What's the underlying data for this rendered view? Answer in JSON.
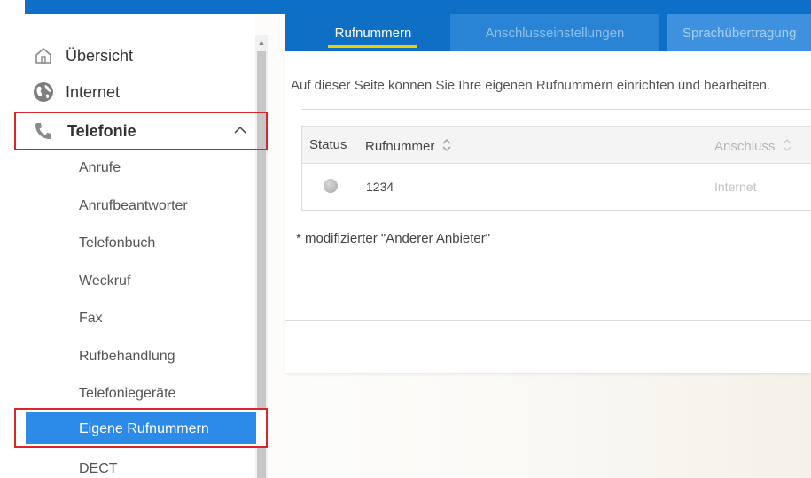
{
  "nav": {
    "overview": "Übersicht",
    "internet": "Internet",
    "telefonie": "Telefonie",
    "sub": {
      "anrufe": "Anrufe",
      "anrufbeantworter": "Anrufbeantworter",
      "telefonbuch": "Telefonbuch",
      "weckruf": "Weckruf",
      "fax": "Fax",
      "rufbehandlung": "Rufbehandlung",
      "telefoniegeraete": "Telefoniegeräte",
      "eigene": "Eigene Rufnummern",
      "dect": "DECT"
    }
  },
  "tabs": [
    "Rufnummern",
    "Anschlusseinstellungen",
    "Sprachübertragung"
  ],
  "intro": "Auf dieser Seite können Sie Ihre eigenen Rufnummern einrichten und bearbeiten.",
  "table": {
    "headers": {
      "status": "Status",
      "rufnummer": "Rufnummer",
      "anschluss": "Anschluss"
    },
    "rows": [
      {
        "rufnummer": "1234",
        "anschluss": "Internet"
      }
    ]
  },
  "note": "* modifizierter \"Anderer Anbieter\"",
  "colors": {
    "brand_blue": "#0d6fc7",
    "selected_blue": "#2c8be6",
    "highlight_red": "#d9262c",
    "tab_underline": "#f2d000"
  }
}
